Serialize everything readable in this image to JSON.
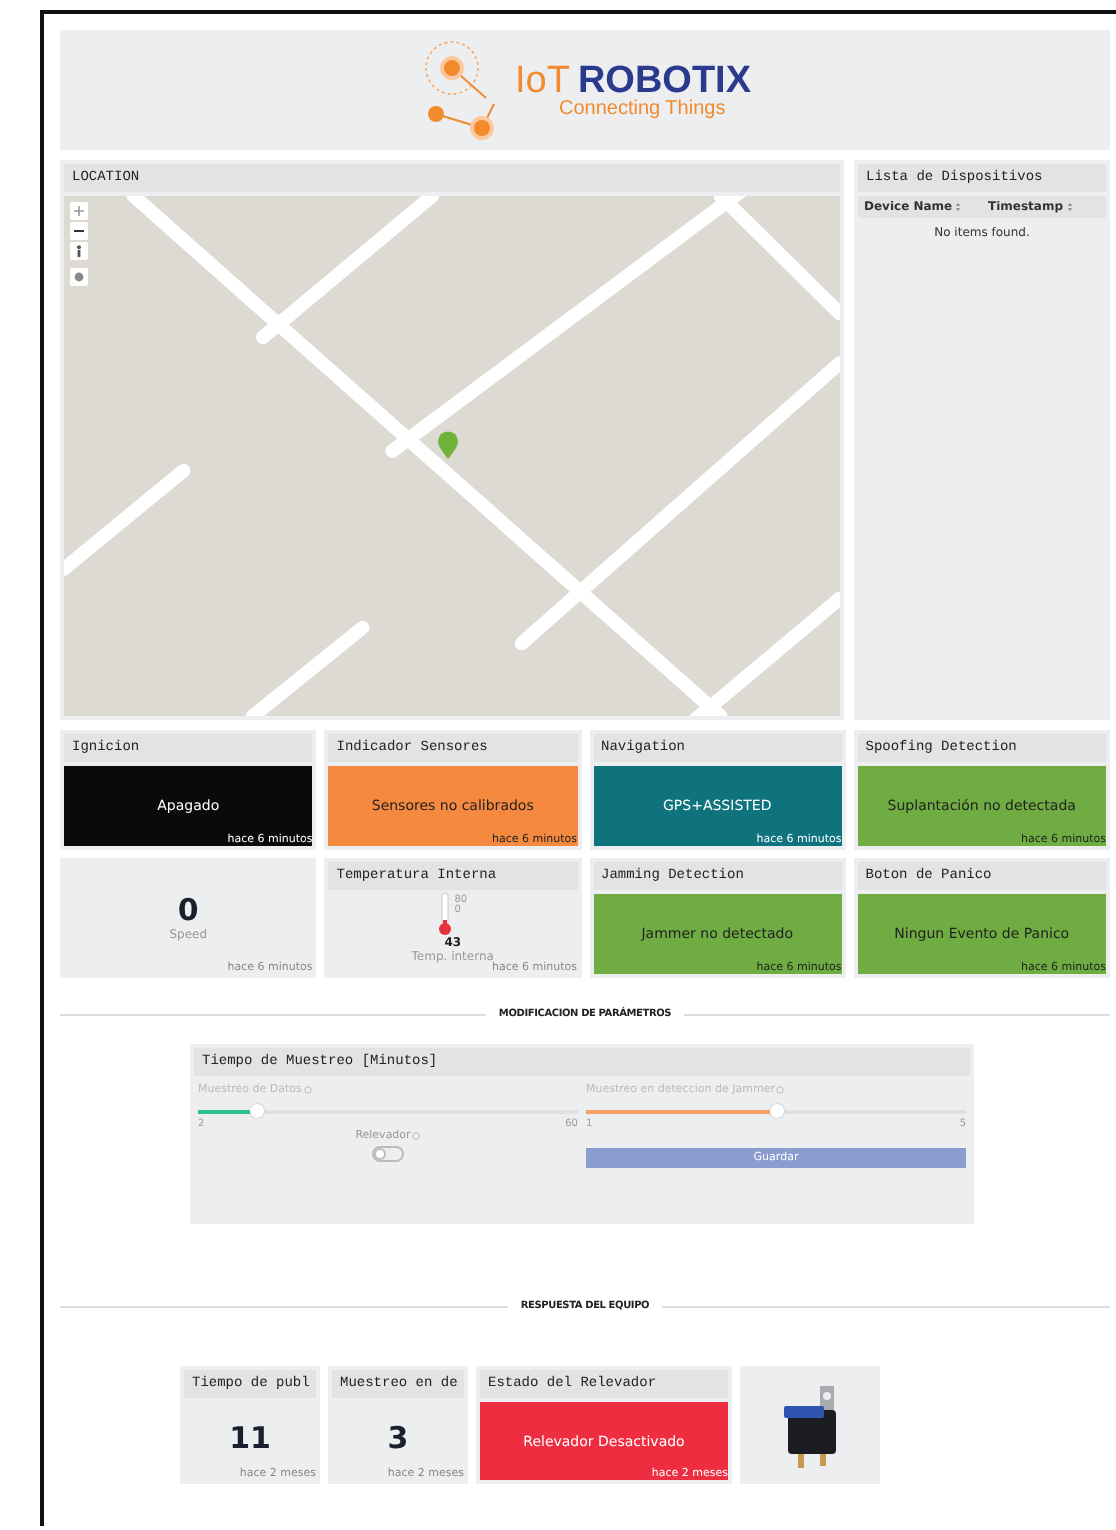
{
  "header": {
    "brand_prefix": "IoT",
    "brand": "ROBOTIX",
    "tagline": "Connecting Things"
  },
  "location": {
    "title": "LOCATION"
  },
  "device_list": {
    "title": "Lista de Dispositivos",
    "columns": [
      "Device Name",
      "Timestamp"
    ],
    "empty_text": "No items found."
  },
  "tiles": [
    {
      "kind": "status",
      "title": "Ignicion",
      "value": "Apagado",
      "time": "hace 6 minutos",
      "color": "#0a0a0c"
    },
    {
      "kind": "status",
      "title": "Indicador Sensores",
      "value": "Sensores no calibrados",
      "time": "hace 6 minutos",
      "color": "#f5893f"
    },
    {
      "kind": "status",
      "title": "Navigation",
      "value": "GPS+ASSISTED",
      "time": "hace 6 minutos",
      "color": "#0e737c"
    },
    {
      "kind": "status",
      "title": "Spoofing Detection",
      "value": "Suplantación no detectada",
      "time": "hace 6 minutos",
      "color": "#6fac41"
    },
    {
      "kind": "number",
      "value": "0",
      "label": "Speed",
      "time": "hace 6 minutos"
    },
    {
      "kind": "gauge",
      "title": "Temperatura Interna",
      "max": "80",
      "min": "0",
      "value": "43",
      "label": "Temp. interna",
      "time": "hace 6 minutos"
    },
    {
      "kind": "status",
      "title": "Jamming Detection",
      "value": "Jammer no detectado",
      "time": "hace 6 minutos",
      "color": "#6fac41"
    },
    {
      "kind": "status",
      "title": "Boton de Panico",
      "value": "Ningun Evento de Panico",
      "time": "hace 6 minutos",
      "color": "#6fac41"
    }
  ],
  "parameters": {
    "heading": "MODIFICACION DE PARÁMETROS",
    "title": "Tiempo de Muestreo [Minutos]",
    "sliders": [
      {
        "label": "Muestreo de Datos",
        "min": "2",
        "max": "60",
        "level": 0.15,
        "color": "#2fbf8a"
      },
      {
        "label": "Muestreo en deteccion de Jammer",
        "min": "1",
        "max": "5",
        "level": 0.5,
        "color": "#f8a06a"
      }
    ],
    "toggle": {
      "label": "Relevador",
      "on": false
    },
    "button": "Guardar"
  },
  "response": {
    "heading": "RESPUESTA DEL EQUIPO",
    "cards": [
      {
        "kind": "number",
        "title": "Tiempo de publ",
        "value": "11",
        "time": "hace 2 meses"
      },
      {
        "kind": "number",
        "title": "Muestreo en de",
        "value": "3",
        "time": "hace 2 meses"
      },
      {
        "kind": "status",
        "title": "Estado del Relevador",
        "value": "Relevador Desactivado",
        "time": "hace 2 meses",
        "color": "#ee2e40"
      },
      {
        "kind": "image"
      }
    ]
  }
}
